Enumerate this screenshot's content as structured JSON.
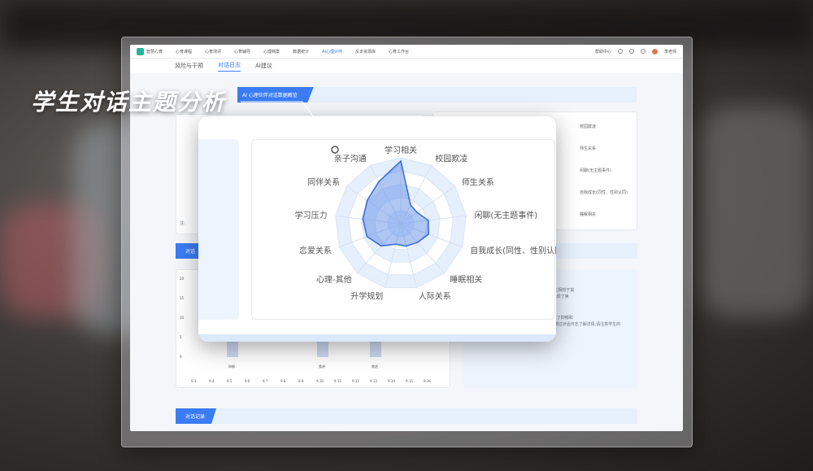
{
  "headline": "学生对话主题分析",
  "app": {
    "name": "智慧心育",
    "nav": [
      "心育课程",
      "心育测评",
      "心育辅导",
      "心理档案",
      "数据统计",
      "AI心理伙伴",
      "反本资源库",
      "心育工作台"
    ],
    "nav_active": "AI心理伙伴",
    "nav_right": {
      "help": "帮助中心",
      "user": "李老师"
    }
  },
  "subtabs": [
    "风险与干预",
    "对话日志",
    "AI建议"
  ],
  "subtab_active": "对话日志",
  "sections": {
    "overview": "AI 心理伙伴对话数据概览",
    "dialogue": "对话",
    "records": "对话记录"
  },
  "left_panel": {
    "label": "情绪",
    "note": "注:"
  },
  "right_legend": [
    "校园欺凌",
    "师生关系",
    "闲聊(无主题事件)",
    "自我成长(同性、性别认同)",
    "睡眠相关"
  ],
  "trend": {
    "y_ticks": [
      "20",
      "15",
      "10",
      "5",
      "0"
    ],
    "x_ticks": [
      "9.3",
      "9.4",
      "9.5",
      "9.6",
      "9.7",
      "9.8",
      "9.9",
      "9.10",
      "9.11",
      "9.12",
      "9.13",
      "9.14",
      "9.15",
      "9.16"
    ],
    "bar_labels": [
      "抑郁",
      "焦虑",
      "焦虑"
    ]
  },
  "insight_text": [
    "...情绪最多,说明学生相较于其",
    "...同时学生在当日出现了焦",
    "...虑情绪。",
    "...学生在对话中出现了抑郁和",
    "焦虑的情绪,您可以通过对话日志了解详情,请注意学生的",
    "情绪变化。"
  ],
  "chart_data": {
    "type": "radar",
    "title": "",
    "categories": [
      "学习相关",
      "校园欺凌",
      "师生关系",
      "闲聊(无主题事件)",
      "自我成长(同性、性别认同)",
      "睡眠相关",
      "人际关系",
      "升学规划",
      "心理-其他",
      "恋爱关系",
      "学习压力",
      "同伴关系",
      "亲子沟通"
    ],
    "series": [
      {
        "values": [
          0.95,
          0.32,
          0.3,
          0.42,
          0.45,
          0.38,
          0.35,
          0.32,
          0.45,
          0.55,
          0.58,
          0.62,
          0.72
        ],
        "color": "#3b6fd8"
      }
    ],
    "rings": 5,
    "range": [
      0,
      1
    ]
  }
}
